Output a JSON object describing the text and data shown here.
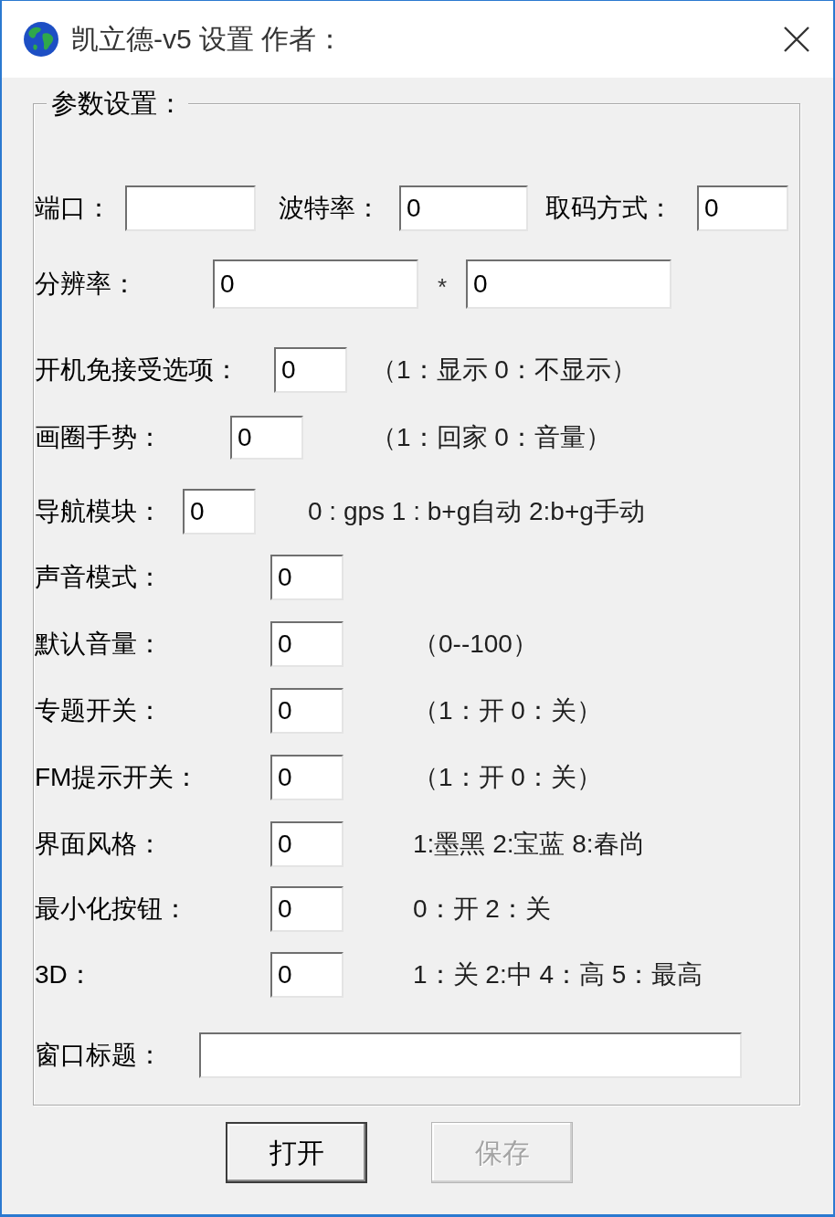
{
  "window": {
    "title": "凯立德-v5 设置 作者："
  },
  "group": {
    "legend": "参数设置："
  },
  "rows": [
    {
      "items": [
        {
          "kind": "label",
          "text": "端口："
        },
        {
          "kind": "field"
        },
        {
          "kind": "label",
          "text": "波特率："
        },
        {
          "kind": "field",
          "value": "0"
        },
        {
          "kind": "label",
          "text": "取码方式："
        },
        {
          "kind": "field",
          "value": "0"
        }
      ]
    },
    {
      "items": [
        {
          "kind": "label",
          "text": "分辨率："
        },
        {
          "kind": "field",
          "value": "0"
        },
        {
          "kind": "separator",
          "text": "*"
        },
        {
          "kind": "field",
          "value": "0"
        }
      ]
    },
    {
      "items": [
        {
          "kind": "label",
          "text": "开机免接受选项："
        },
        {
          "kind": "field",
          "value": "0"
        },
        {
          "kind": "hint",
          "text": "（1：显示 0：不显示）"
        }
      ]
    },
    {
      "items": [
        {
          "kind": "label",
          "text": "画圈手势："
        },
        {
          "kind": "field",
          "value": "0"
        },
        {
          "kind": "hint",
          "text": "（1：回家 0：音量）"
        }
      ]
    },
    {
      "items": [
        {
          "kind": "label",
          "text": "导航模块："
        },
        {
          "kind": "field",
          "value": "0"
        },
        {
          "kind": "hint",
          "text": "0 : gps 1 : b+g自动 2:b+g手动"
        }
      ]
    },
    {
      "items": [
        {
          "kind": "label",
          "text": "声音模式："
        },
        {
          "kind": "field",
          "value": "0"
        }
      ]
    },
    {
      "items": [
        {
          "kind": "label",
          "text": "默认音量："
        },
        {
          "kind": "field",
          "value": "0"
        },
        {
          "kind": "hint",
          "text": "（0--100）"
        }
      ]
    },
    {
      "items": [
        {
          "kind": "label",
          "text": "专题开关："
        },
        {
          "kind": "field",
          "value": "0"
        },
        {
          "kind": "hint",
          "text": "（1：开 0：关）"
        }
      ]
    },
    {
      "items": [
        {
          "kind": "label",
          "text": "FM提示开关："
        },
        {
          "kind": "field",
          "value": "0"
        },
        {
          "kind": "hint",
          "text": "（1：开 0：关）"
        }
      ]
    },
    {
      "items": [
        {
          "kind": "label",
          "text": "界面风格："
        },
        {
          "kind": "field",
          "value": "0"
        },
        {
          "kind": "hint",
          "text": "1:墨黑 2:宝蓝 8:春尚"
        }
      ]
    },
    {
      "items": [
        {
          "kind": "label",
          "text": "最小化按钮："
        },
        {
          "kind": "field",
          "value": "0"
        },
        {
          "kind": "hint",
          "text": "0：开 2：关"
        }
      ]
    },
    {
      "items": [
        {
          "kind": "label",
          "text": "3D："
        },
        {
          "kind": "field",
          "value": "0"
        },
        {
          "kind": "hint",
          "text": "1：关 2:中 4：高 5：最高"
        }
      ]
    },
    {
      "items": [
        {
          "kind": "label",
          "text": "窗口标题："
        },
        {
          "kind": "field"
        }
      ]
    }
  ],
  "buttons": [
    {
      "label": "打开",
      "disabled": false
    },
    {
      "label": "保存",
      "disabled": true
    }
  ]
}
